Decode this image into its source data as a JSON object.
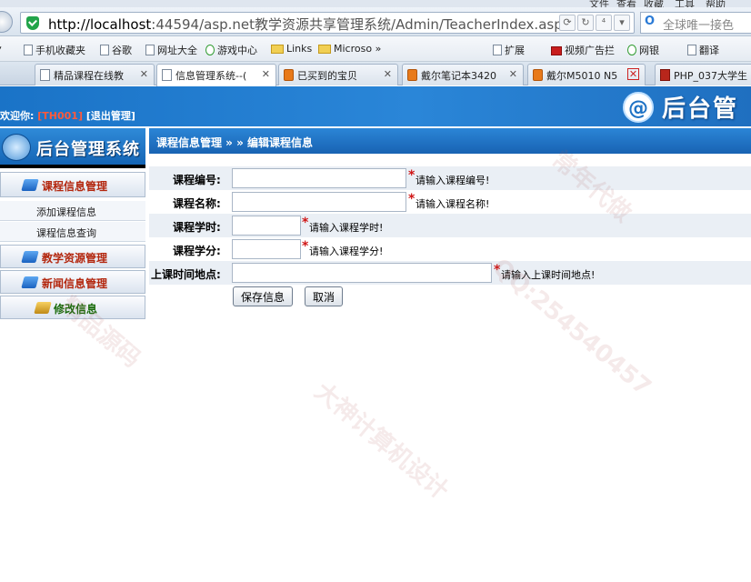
{
  "browser": {
    "menu_items": [
      "文件",
      "查看",
      "收藏",
      "工具",
      "帮助"
    ],
    "url_host": "http://localhost",
    "url_rest": ":44594/asp.net教学资源共享管理系统/Admin/TeacherIndex.aspx",
    "search_placeholder": "全球唯一接色",
    "favorites": [
      "手机收藏夹",
      "谷歌",
      "网址大全",
      "游戏中心",
      "Links",
      "Microso »",
      "扩展",
      "视频广告拦",
      "网银",
      "翻译"
    ],
    "tabs": [
      {
        "title": "精品课程在线教"
      },
      {
        "title": "信息管理系统--("
      },
      {
        "title": "已买到的宝贝"
      },
      {
        "title": "戴尔笔记本3420"
      },
      {
        "title": "戴尔M5010 N5"
      },
      {
        "title": "PHP_037大学生"
      }
    ]
  },
  "header": {
    "system_title": "后台管",
    "at_symbol": "@",
    "welcome_label": "欢迎你:",
    "user_id": "[TH001]",
    "logout": "[退出管理]"
  },
  "sidebar": {
    "title": "后台管理系统",
    "course_section": "课程信息管理",
    "course_items": [
      "添加课程信息",
      "课程信息查询"
    ],
    "resource_section": "教学资源管理",
    "news_section": "新闻信息管理",
    "edit_section": "修改信息"
  },
  "main": {
    "breadcrumb": "课程信息管理 » » 编辑课程信息",
    "fields": [
      {
        "label": "课程编号:",
        "value": "",
        "hint": "请输入课程编号!"
      },
      {
        "label": "课程名称:",
        "value": "",
        "hint": "请输入课程名称!"
      },
      {
        "label": "课程学时:",
        "value": "",
        "hint": "请输入课程学时!"
      },
      {
        "label": "课程学分:",
        "value": "",
        "hint": "请输入课程学分!"
      },
      {
        "label": "上课时间地点:",
        "value": "",
        "hint": "请输入上课时间地点!"
      }
    ],
    "required_mark": "*",
    "save_button": "保存信息",
    "cancel_button": "取消"
  },
  "watermark": {
    "lines": [
      "QQ:254540457",
      "大神计算机设计",
      "精品源码",
      "常年代做"
    ]
  }
}
